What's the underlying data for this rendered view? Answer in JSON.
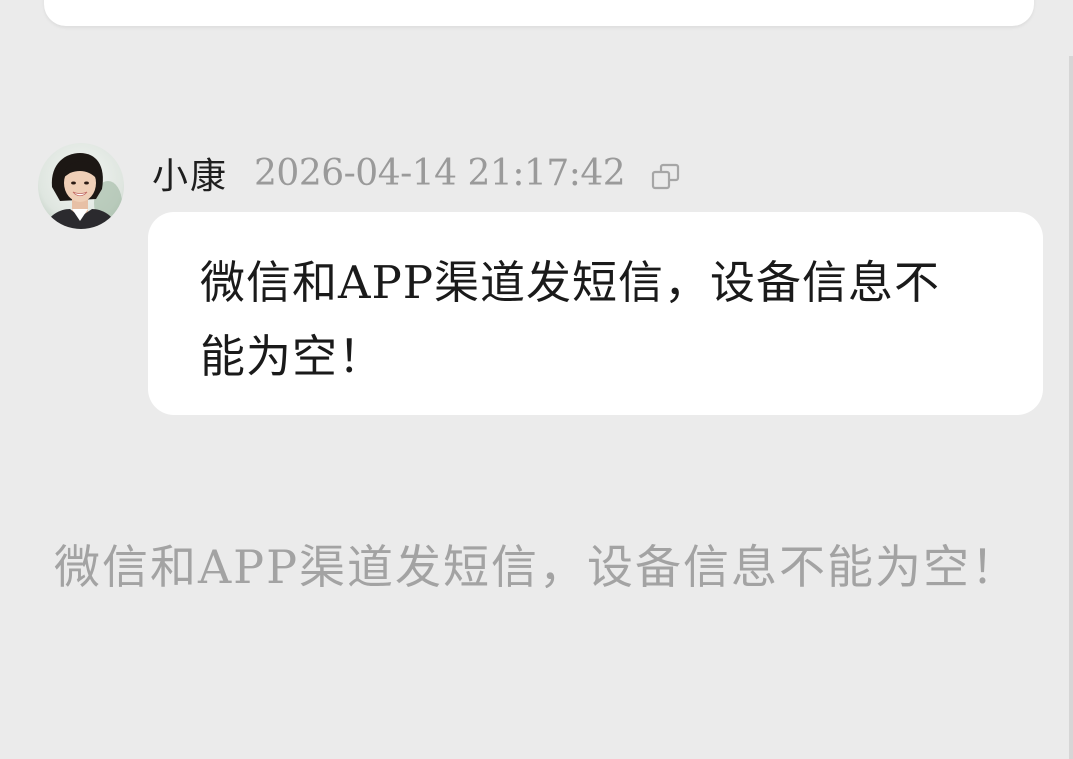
{
  "message": {
    "sender_name": "小康",
    "timestamp": "2026-04-14 21:17:42",
    "text": "微信和APP渠道发短信，设备信息不能为空！"
  },
  "system_notice": {
    "text": "微信和APP渠道发短信，设备信息不能为空！"
  },
  "icons": {
    "avatar": "user-avatar-photo",
    "copy": "copy-icon"
  },
  "colors": {
    "background": "#ebebeb",
    "bubble": "#ffffff",
    "sender_text": "#1f1f1f",
    "muted_text": "#9a9a9a"
  }
}
